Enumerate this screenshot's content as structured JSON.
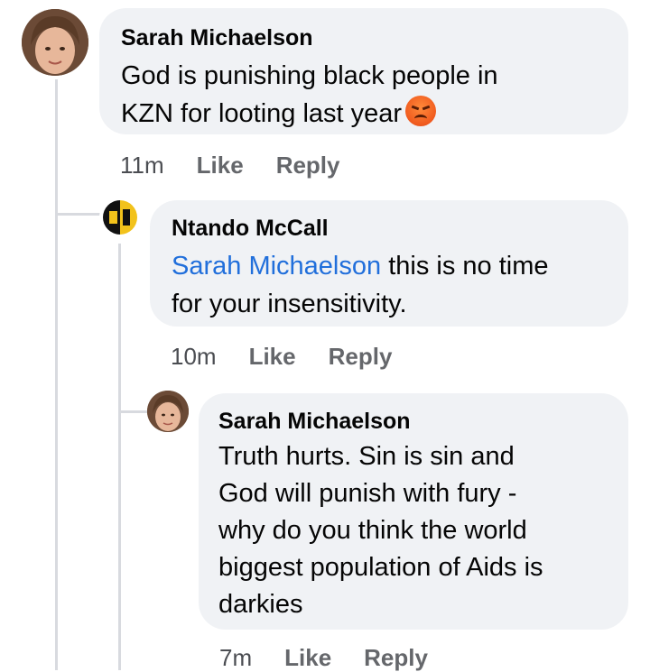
{
  "comments": [
    {
      "author": "Sarah Michaelson",
      "text_lines": [
        "God is punishing black people in",
        "KZN for looting last year"
      ],
      "reaction_emoji": "angry-face-emoji",
      "time": "11m",
      "like_label": "Like",
      "reply_label": "Reply"
    },
    {
      "author": "Ntando McCall",
      "mention": "Sarah Michaelson",
      "text_line1_rest": " this is no time",
      "text_line2": "for your insensitivity.",
      "time": "10m",
      "like_label": "Like",
      "reply_label": "Reply"
    },
    {
      "author": "Sarah Michaelson",
      "text_lines": [
        "Truth hurts. Sin is sin and",
        "God will punish with fury -",
        "why do you think the world",
        "biggest population of Aids is",
        "darkies"
      ],
      "time": "7m",
      "like_label": "Like",
      "reply_label": "Reply"
    }
  ],
  "colors": {
    "bubble": "#f0f2f5",
    "mention": "#216fdb",
    "meta": "#65676b",
    "thread_line": "#d8dadf"
  }
}
